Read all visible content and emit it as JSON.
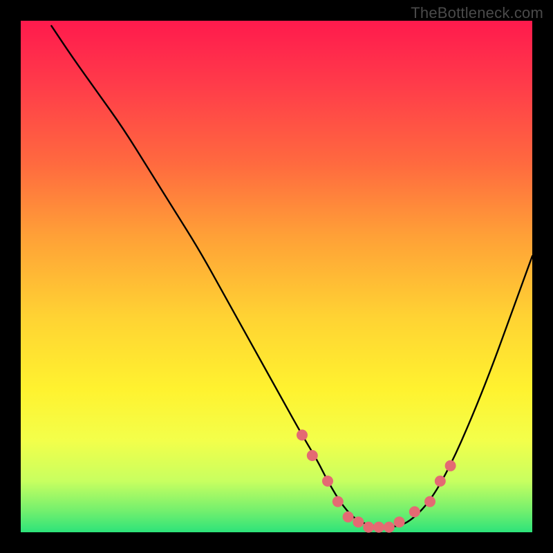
{
  "attribution": "TheBottleneck.com",
  "chart_data": {
    "type": "line",
    "title": "",
    "xlabel": "",
    "ylabel": "",
    "xlim": [
      0,
      100
    ],
    "ylim": [
      0,
      100
    ],
    "series": [
      {
        "name": "bottleneck-curve",
        "x": [
          6,
          10,
          15,
          20,
          25,
          30,
          35,
          40,
          45,
          50,
          55,
          58,
          60,
          63,
          66,
          70,
          73,
          76,
          80,
          84,
          88,
          92,
          96,
          100
        ],
        "values": [
          99,
          93,
          86,
          79,
          71,
          63,
          55,
          46,
          37,
          28,
          19,
          14,
          10,
          5,
          2,
          1,
          1,
          2,
          6,
          13,
          22,
          32,
          43,
          54
        ]
      }
    ],
    "markers": {
      "name": "highlight-points",
      "color": "#e46a73",
      "x": [
        55,
        57,
        60,
        62,
        64,
        66,
        68,
        70,
        72,
        74,
        77,
        80,
        82,
        84
      ],
      "values": [
        19,
        15,
        10,
        6,
        3,
        2,
        1,
        1,
        1,
        2,
        4,
        6,
        10,
        13
      ]
    }
  }
}
